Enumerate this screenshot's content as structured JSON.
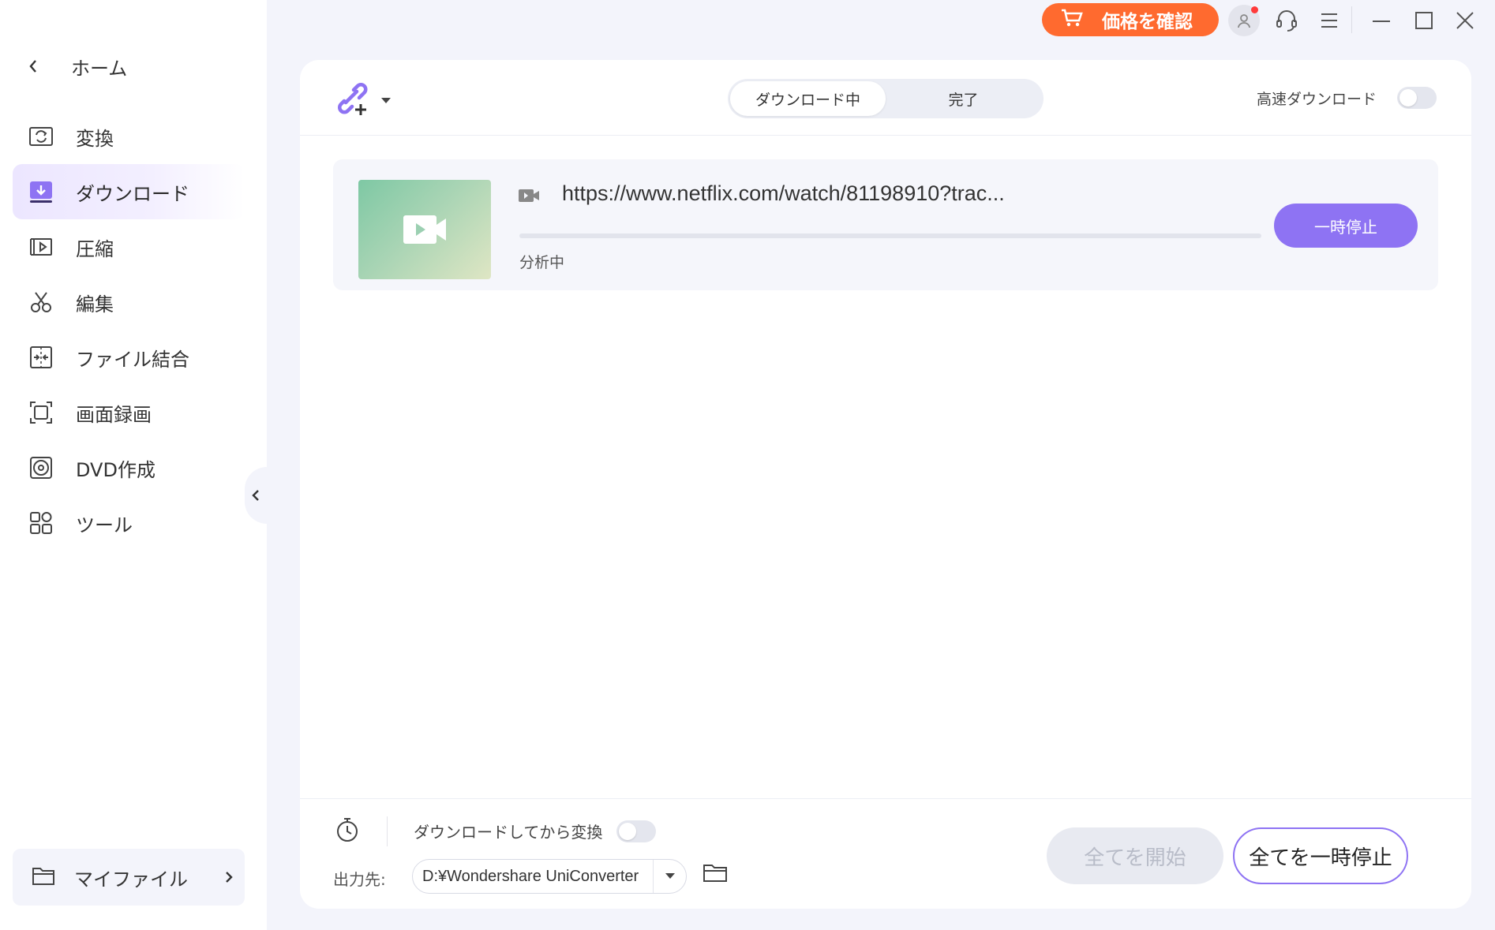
{
  "titlebar": {
    "price_button": "価格を確認",
    "colors": {
      "price_bg": "#ff6a2f"
    }
  },
  "sidebar": {
    "home_label": "ホーム",
    "items": [
      {
        "label": "変換",
        "icon": "convert-icon"
      },
      {
        "label": "ダウンロード",
        "icon": "download-icon",
        "active": true
      },
      {
        "label": "圧縮",
        "icon": "compress-icon"
      },
      {
        "label": "編集",
        "icon": "scissors-icon"
      },
      {
        "label": "ファイル結合",
        "icon": "merge-icon"
      },
      {
        "label": "画面録画",
        "icon": "screen-record-icon"
      },
      {
        "label": "DVD作成",
        "icon": "disc-icon"
      },
      {
        "label": "ツール",
        "icon": "tools-grid-icon"
      }
    ],
    "myfiles_label": "マイファイル"
  },
  "main": {
    "tabs": [
      {
        "label": "ダウンロード中",
        "active": true
      },
      {
        "label": "完了",
        "active": false
      }
    ],
    "fast_download_label": "高速ダウンロード",
    "fast_download_on": false,
    "tasks": [
      {
        "url": "https://www.netflix.com/watch/81198910?trac...",
        "status": "分析中",
        "pause_label": "一時停止",
        "progress": 0
      }
    ],
    "footer": {
      "convert_after_label": "ダウンロードしてから変換",
      "convert_after_on": false,
      "output_label": "出力先:",
      "output_path": "D:¥Wondershare UniConverter",
      "start_all_label": "全てを開始",
      "pause_all_label": "全てを一時停止"
    }
  },
  "colors": {
    "accent": "#8e73f3",
    "background": "#f3f4fb"
  }
}
